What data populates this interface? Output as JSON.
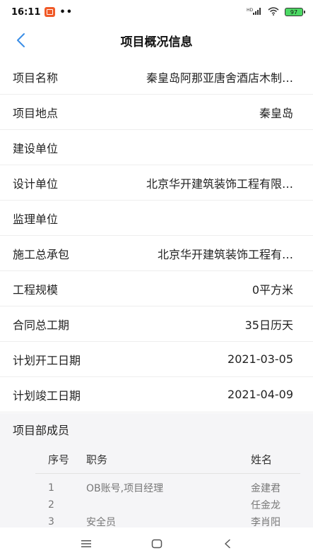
{
  "status_bar": {
    "time": "16:11",
    "dots": "••",
    "signal_text": "HD",
    "battery": "97",
    "icons": [
      "notification-app-icon",
      "signal-icon",
      "wifi-icon",
      "battery-icon"
    ]
  },
  "nav": {
    "title": "项目概况信息",
    "back_icon": "chevron-left-icon"
  },
  "fields": [
    {
      "label": "项目名称",
      "value": "秦皇岛阿那亚唐舍酒店木制…"
    },
    {
      "label": "项目地点",
      "value": "秦皇岛"
    },
    {
      "label": "建设单位",
      "value": ""
    },
    {
      "label": "设计单位",
      "value": "北京华开建筑装饰工程有限…"
    },
    {
      "label": "监理单位",
      "value": ""
    },
    {
      "label": "施工总承包",
      "value": "北京华开建筑装饰工程有…"
    },
    {
      "label": "工程规模",
      "value": "0平方米"
    },
    {
      "label": "合同总工期",
      "value": "35日历天"
    },
    {
      "label": "计划开工日期",
      "value": "2021-03-05"
    },
    {
      "label": "计划竣工日期",
      "value": "2021-04-09"
    }
  ],
  "members": {
    "title": "项目部成员",
    "columns": [
      "序号",
      "职务",
      "姓名"
    ],
    "rows": [
      [
        "1",
        "OB账号,项目经理",
        "金建君"
      ],
      [
        "2",
        "",
        "任金龙"
      ],
      [
        "3",
        "安全员",
        "李肖阳"
      ]
    ]
  },
  "bottom_nav": {
    "icons": [
      "menu-icon",
      "home-square-icon",
      "back-triangle-icon"
    ]
  },
  "colors": {
    "accent": "#3a8ee6",
    "section_bg": "#f5f5f7",
    "divider": "#eeeeee"
  }
}
